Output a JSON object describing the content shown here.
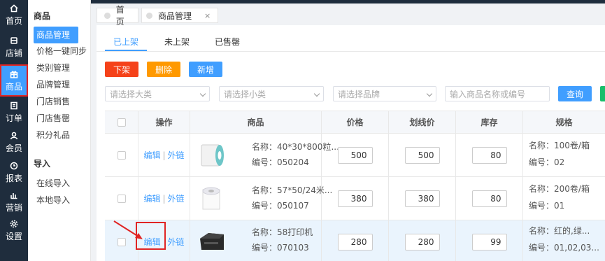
{
  "rail": [
    {
      "label": "首页",
      "icon": "home-icon"
    },
    {
      "label": "店铺",
      "icon": "store-icon"
    },
    {
      "label": "商品",
      "icon": "gift-icon",
      "active": true
    },
    {
      "label": "订单",
      "icon": "order-icon"
    },
    {
      "label": "会员",
      "icon": "member-icon"
    },
    {
      "label": "报表",
      "icon": "report-icon"
    },
    {
      "label": "营销",
      "icon": "chart-icon"
    },
    {
      "label": "设置",
      "icon": "gear-icon"
    }
  ],
  "menu": {
    "section1": "商品",
    "items1": [
      "商品管理",
      "价格一键同步",
      "类别管理",
      "品牌管理",
      "门店销售",
      "门店售罄",
      "积分礼品"
    ],
    "section2": "导入",
    "items2": [
      "在线导入",
      "本地导入"
    ]
  },
  "tabs": [
    {
      "label": "首页"
    },
    {
      "label": "商品管理",
      "close": "×"
    }
  ],
  "subtabs": [
    "已上架",
    "未上架",
    "已售罄"
  ],
  "actions": {
    "off_shelf": "下架",
    "delete": "删除",
    "add": "新增",
    "query": "查询"
  },
  "filters": {
    "category": "请选择大类",
    "subcategory": "请选择小类",
    "brand": "请选择品牌",
    "keyword_placeholder": "输入商品名称或编号"
  },
  "table": {
    "headers": [
      "操作",
      "商品",
      "价格",
      "划线价",
      "库存",
      "规格"
    ],
    "edit": "编辑",
    "link": "外链",
    "rows": [
      {
        "name": "名称：40*30*800粒...",
        "code": "编号：050204",
        "price": "500",
        "list_price": "500",
        "stock": "80",
        "spec_name": "名称：100卷/箱",
        "spec_code": "编号：02"
      },
      {
        "name": "名称：57*50/24米...",
        "code": "编号：050107",
        "price": "380",
        "list_price": "380",
        "stock": "80",
        "spec_name": "名称：200卷/箱",
        "spec_code": "编号：01"
      },
      {
        "name": "名称：58打印机",
        "code": "编号：070103",
        "price": "280",
        "list_price": "280",
        "stock": "99",
        "spec_name": "名称：红的,绿...",
        "spec_code": "编号：01,02,03..."
      }
    ]
  },
  "colors": {
    "accent": "#409eff",
    "danger": "#f5421a",
    "warning": "#ff9900",
    "success": "#19be6b",
    "highlight": "#e02424"
  }
}
